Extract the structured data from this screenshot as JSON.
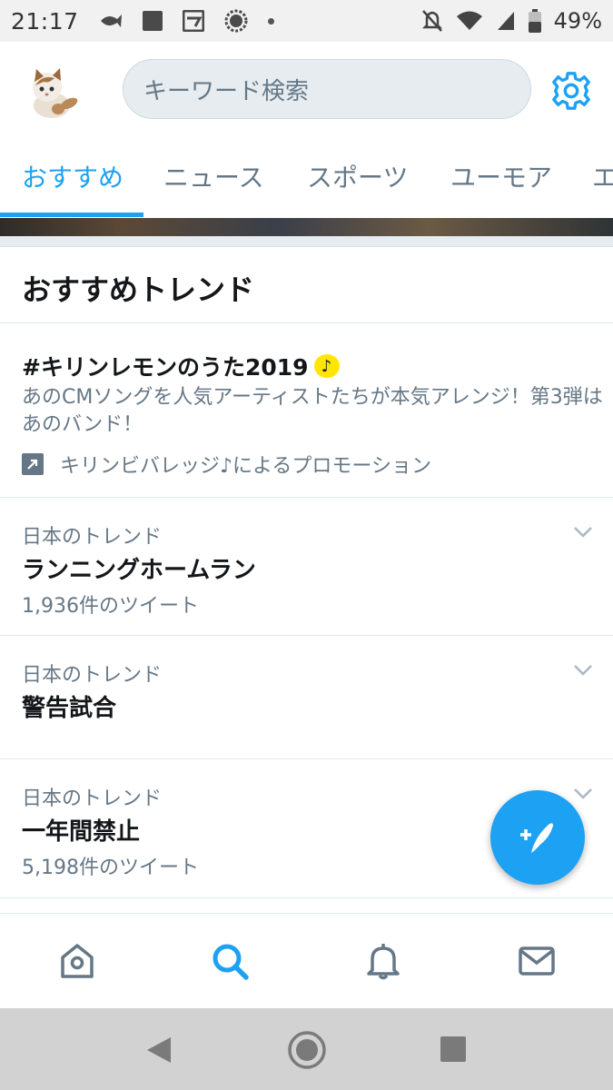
{
  "status_bar": {
    "time": "21:17",
    "battery": "49%"
  },
  "header": {
    "search_placeholder": "キーワード検索",
    "avatar": "cat-avatar",
    "settings_icon": "gear-icon"
  },
  "tabs": [
    {
      "label": "おすすめ",
      "active": true
    },
    {
      "label": "ニュース",
      "active": false
    },
    {
      "label": "スポーツ",
      "active": false
    },
    {
      "label": "ユーモア",
      "active": false
    },
    {
      "label": "エ",
      "active": false
    }
  ],
  "section": {
    "title": "おすすめトレンド"
  },
  "promoted": {
    "title": "#キリンレモンのうた2019",
    "note_glyph": "♪",
    "description": "あのCMソングを人気アーティストたちが本気アレンジ！第3弾はあのバンド！",
    "promoted_by": "キリンビバレッジ♪によるプロモーション"
  },
  "trends": [
    {
      "context": "日本のトレンド",
      "name": "ランニングホームラン",
      "count": "1,936件のツイート"
    },
    {
      "context": "日本のトレンド",
      "name": "警告試合",
      "count": ""
    },
    {
      "context": "日本のトレンド",
      "name": "一年間禁止",
      "count": "5,198件のツイート"
    }
  ],
  "colors": {
    "accent": "#1da1f2",
    "secondary_text": "#657786",
    "primary_text": "#14171a"
  }
}
